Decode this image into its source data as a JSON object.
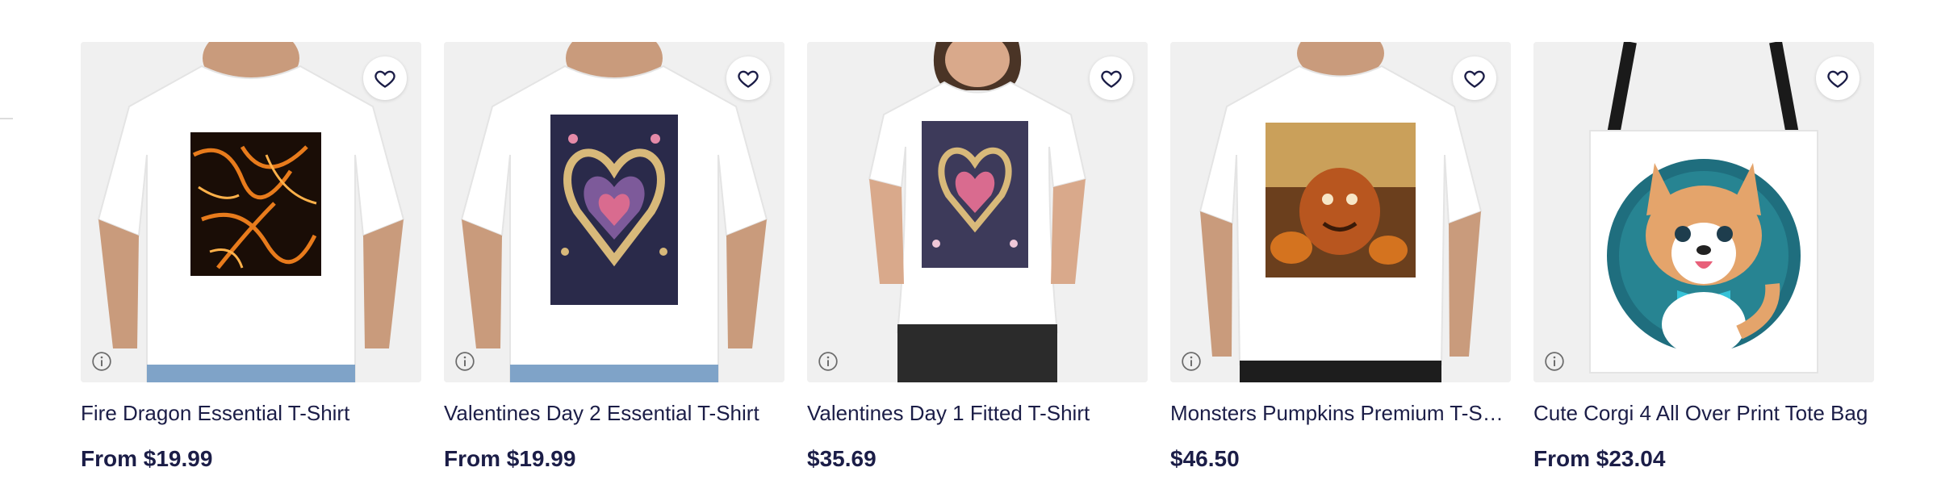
{
  "products": [
    {
      "title": "Fire Dragon Essential T-Shirt",
      "price": "From $19.99",
      "favorite_icon": "heart-outline-icon",
      "info_icon": "info-icon",
      "design": "fire-lava-pattern"
    },
    {
      "title": "Valentines Day 2 Essential T-Shirt",
      "price": "From $19.99",
      "favorite_icon": "heart-outline-icon",
      "info_icon": "info-icon",
      "design": "gold-heart-pattern"
    },
    {
      "title": "Valentines Day 1 Fitted T-Shirt",
      "price": "$35.69",
      "favorite_icon": "heart-outline-icon",
      "info_icon": "info-icon",
      "design": "heart-pattern-fitted"
    },
    {
      "title": "Monsters Pumpkins Premium T-Shirt",
      "price": "$46.50",
      "favorite_icon": "heart-outline-icon",
      "info_icon": "info-icon",
      "design": "monster-pumpkins"
    },
    {
      "title": "Cute Corgi 4 All Over Print Tote Bag",
      "price": "From $23.04",
      "favorite_icon": "heart-outline-icon",
      "info_icon": "info-icon",
      "design": "corgi-tote"
    }
  ],
  "colors": {
    "text": "#1b1d47",
    "thumb_bg": "#f2f2f2",
    "shirt": "#ffffff"
  }
}
